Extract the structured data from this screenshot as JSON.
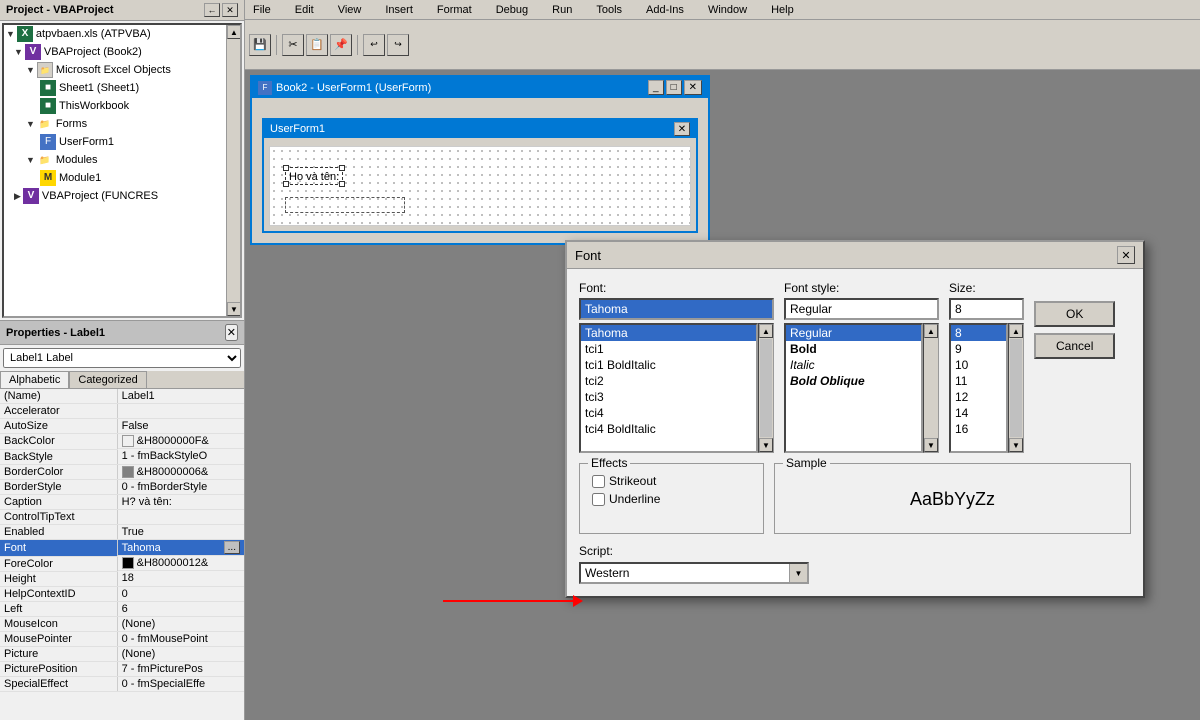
{
  "app": {
    "title": "Book2 - UserForm1 (UserForm)"
  },
  "menubar": {
    "items": [
      "File",
      "Edit",
      "View",
      "Insert",
      "Format",
      "Debug",
      "Run",
      "Tools",
      "Add-Ins",
      "Window",
      "Help"
    ]
  },
  "projectTree": {
    "title": "Project - VBAProject",
    "items": [
      {
        "label": "atpvbaen.xls (ATPVBA)",
        "indent": 0,
        "type": "excel",
        "expand": true
      },
      {
        "label": "VBAProject (Book2)",
        "indent": 1,
        "type": "vba",
        "expand": true
      },
      {
        "label": "Microsoft Excel Objects",
        "indent": 2,
        "type": "folder",
        "expand": true
      },
      {
        "label": "Sheet1 (Sheet1)",
        "indent": 3,
        "type": "sheet"
      },
      {
        "label": "ThisWorkbook",
        "indent": 3,
        "type": "sheet"
      },
      {
        "label": "Forms",
        "indent": 2,
        "type": "folder",
        "expand": true
      },
      {
        "label": "UserForm1",
        "indent": 3,
        "type": "form"
      },
      {
        "label": "Modules",
        "indent": 2,
        "type": "folder",
        "expand": true
      },
      {
        "label": "Module1",
        "indent": 3,
        "type": "module"
      },
      {
        "label": "VBAProject (FUNCRES)",
        "indent": 1,
        "type": "vba"
      }
    ]
  },
  "properties": {
    "title": "Properties - Label1",
    "dropdown": "Label1 Label",
    "tabs": [
      "Alphabetic",
      "Categorized"
    ],
    "activeTab": 0,
    "rows": [
      {
        "name": "(Name)",
        "value": "Label1"
      },
      {
        "name": "Accelerator",
        "value": ""
      },
      {
        "name": "AutoSize",
        "value": "False"
      },
      {
        "name": "BackColor",
        "value": "&H8000000F&"
      },
      {
        "name": "BackStyle",
        "value": "1 - fmBackStyleO"
      },
      {
        "name": "BorderColor",
        "value": "&H80000006&"
      },
      {
        "name": "BorderStyle",
        "value": "0 - fmBorderStyle"
      },
      {
        "name": "Caption",
        "value": "H? và tên:"
      },
      {
        "name": "ControlTipText",
        "value": ""
      },
      {
        "name": "Enabled",
        "value": "True"
      },
      {
        "name": "Font",
        "value": "Tahoma",
        "hasButton": true,
        "highlighted": true
      },
      {
        "name": "ForeColor",
        "value": "&H80000012&"
      },
      {
        "name": "Height",
        "value": "18"
      },
      {
        "name": "HelpContextID",
        "value": "0"
      },
      {
        "name": "Left",
        "value": "6"
      },
      {
        "name": "MouseIcon",
        "value": "(None)"
      },
      {
        "name": "MousePointer",
        "value": "0 - fmMousePoint"
      },
      {
        "name": "Picture",
        "value": "(None)"
      },
      {
        "name": "PicturePosition",
        "value": "7 - fmPicturePos"
      },
      {
        "name": "SpecialEffect",
        "value": "0 - fmSpecialEffe"
      }
    ]
  },
  "userform": {
    "title": "UserForm1",
    "labelText": "Họ và tên:"
  },
  "fontDialog": {
    "title": "Font",
    "fontLabel": "Font:",
    "fontInput": "Tahoma",
    "fontStyleLabel": "Font style:",
    "fontStyleInput": "Regular",
    "sizeLabel": "Size:",
    "sizeInput": "8",
    "fontList": [
      "Tahoma",
      "tci1",
      "tci1 BoldItalic",
      "tci2",
      "tci3",
      "tci4",
      "tci4 BoldItalic"
    ],
    "selectedFont": "Tahoma",
    "fontStyleList": [
      "Regular",
      "Bold",
      "Italic",
      "Bold Oblique"
    ],
    "selectedStyle": "Regular",
    "sizeList": [
      "8",
      "9",
      "10",
      "11",
      "12",
      "14",
      "16"
    ],
    "selectedSize": "8",
    "effects": {
      "label": "Effects",
      "strikeout": "Strikeout",
      "underline": "Underline"
    },
    "sample": {
      "label": "Sample",
      "text": "AaBbYyZz"
    },
    "script": {
      "label": "Script:",
      "value": "Western"
    },
    "okButton": "OK",
    "cancelButton": "Cancel"
  }
}
